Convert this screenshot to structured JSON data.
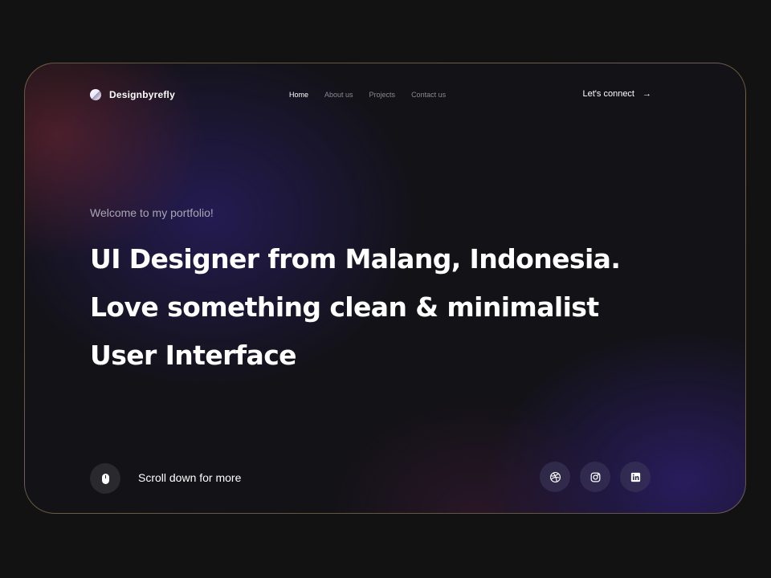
{
  "brand": {
    "name": "Designbyrefly",
    "logo_icon": "half-circle-logo-icon"
  },
  "nav": {
    "items": [
      {
        "label": "Home",
        "active": true
      },
      {
        "label": "About us",
        "active": false
      },
      {
        "label": "Projects",
        "active": false
      },
      {
        "label": "Contact us",
        "active": false
      }
    ]
  },
  "cta": {
    "label": "Let's connect",
    "icon": "arrow-right-icon"
  },
  "hero": {
    "welcome": "Welcome to my portfolio!",
    "lines": [
      "UI Designer from Malang, Indonesia.",
      "Love something clean & minimalist",
      "User Interface"
    ]
  },
  "footer": {
    "scroll_icon": "mouse-icon",
    "scroll_label": "Scroll down for more",
    "socials": [
      {
        "name": "dribbble",
        "icon": "dribbble-icon"
      },
      {
        "name": "instagram",
        "icon": "instagram-icon"
      },
      {
        "name": "linkedin",
        "icon": "linkedin-icon"
      }
    ]
  },
  "colors": {
    "background": "#121212",
    "card_border": "#c8af78",
    "text_primary": "#ffffff",
    "text_muted": "#8a8892",
    "accent_purple": "#372388"
  }
}
